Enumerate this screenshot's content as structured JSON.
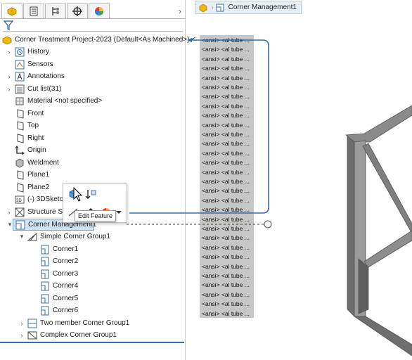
{
  "tabs": [
    {
      "icon": "feature-manager-icon",
      "active": true
    },
    {
      "icon": "property-manager-icon",
      "active": false
    },
    {
      "icon": "configuration-manager-icon",
      "active": false
    },
    {
      "icon": "dimxpert-manager-icon",
      "active": false
    },
    {
      "icon": "display-manager-icon",
      "active": false
    }
  ],
  "tree": {
    "root": "Corner Treatment Project-2023 (Default<As Machined>) <",
    "items": [
      {
        "label": "History",
        "icon": "history-icon",
        "expandable": true
      },
      {
        "label": "Sensors",
        "icon": "sensors-icon",
        "expandable": false
      },
      {
        "label": "Annotations",
        "icon": "annotations-icon",
        "expandable": true
      },
      {
        "label": "Cut list(31)",
        "icon": "cut-list-icon",
        "expandable": true
      },
      {
        "label": "Material <not specified>",
        "icon": "material-icon",
        "expandable": false
      },
      {
        "label": "Front",
        "icon": "plane-icon",
        "expandable": false
      },
      {
        "label": "Top",
        "icon": "plane-icon",
        "expandable": false
      },
      {
        "label": "Right",
        "icon": "plane-icon",
        "expandable": false
      },
      {
        "label": "Origin",
        "icon": "origin-icon",
        "expandable": false
      },
      {
        "label": "Weldment",
        "icon": "weldment-icon",
        "expandable": false
      },
      {
        "label": "Plane1",
        "icon": "plane-icon",
        "expandable": false
      },
      {
        "label": "Plane2",
        "icon": "plane-icon",
        "expandable": false
      },
      {
        "label": "(-) 3DSketch",
        "icon": "3dsketch-icon",
        "expandable": false
      },
      {
        "label": "Structure Sy",
        "icon": "structure-system-icon",
        "expandable": true
      },
      {
        "label": "Corner Management1",
        "icon": "corner-management-icon",
        "expandable": true,
        "selected": true
      }
    ],
    "group1": {
      "label": "Simple Corner Group1",
      "children": [
        "Corner1",
        "Corner2",
        "Corner3",
        "Corner4",
        "Corner5",
        "Corner6"
      ]
    },
    "group2": "Two member Corner Group1",
    "group3": "Complex Corner Group1"
  },
  "popup": {
    "tooltip": "Edit Feature"
  },
  "breadcrumb": {
    "label": "Corner Management1"
  },
  "ansi_items": [
    "<ansi> <al tube ...",
    "<ansi> <al tube ...",
    "<ansi> <al tube ...",
    "<ansi> <al tube ...",
    "<ansi> <al tube ...",
    "<ansi> <al tube ...",
    "<ansi> <al tube ...",
    "<ansi> <al tube ...",
    "<ansi> <al tube ...",
    "<ansi> <al tube ...",
    "<ansi> <al tube ...",
    "<ansi> <al tube ...",
    "<ansi> <al tube ...",
    "<ansi> <al tube ...",
    "<ansi> <al tube ...",
    "<ansi> <al tube ...",
    "<ansi> <al tube ...",
    "<ansi> <al tube ...",
    "<ansi> <al tube ...",
    "<ansi> <al tube ...",
    "<ansi> <al tube ...",
    "<ansi> <al tube ...",
    "<ansi> <al tube ...",
    "<ansi> <al tube ...",
    "<ansi> <al tube ...",
    "<ansi> <al tube ...",
    "<ansi> <al tube ...",
    "<ansi> <al tube ...",
    "<ansi> <al tube ...",
    "<ansi> <al tube ..."
  ],
  "colors": {
    "connector": "#2f6fad",
    "selection": "#cfe3f7",
    "ansi_bg": "#c6c6c6",
    "frame_gray": "#7a7a7a"
  }
}
